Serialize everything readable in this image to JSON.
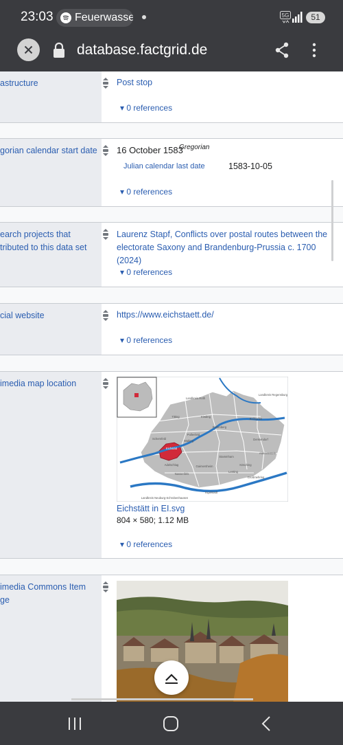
{
  "status_bar": {
    "time": "23:03",
    "notification_text": "Feuerwasse",
    "network_label": "5G",
    "battery": "51"
  },
  "browser": {
    "url": "database.factgrid.de"
  },
  "statements": [
    {
      "property": "astructure",
      "value": "Post stop",
      "references": "0 references"
    },
    {
      "property": "gorian calendar start date",
      "value": "16 October 1583",
      "calendar_note": "Gregorian",
      "qualifier_label": "Julian calendar last date",
      "qualifier_value": "1583-10-05",
      "references": "0 references"
    },
    {
      "property": "earch projects that\ntributed to this data set",
      "value": "Laurenz Stapf, Conflicts over postal routes between the electorate Saxony and Brandenburg-Prussia c. 1700 (2024)",
      "references": "0 references"
    },
    {
      "property": "cial website",
      "value": "https://www.eichstaett.de/",
      "references": "0 references"
    },
    {
      "property": "imedia map location",
      "file_name": "Eichstätt in EI.svg",
      "file_info": "804 × 580; 1.12 MB",
      "references": "0 references"
    },
    {
      "property": "imedia Commons Item\nge"
    }
  ],
  "map": {
    "labels": [
      "Landkreis Roth",
      "Titting",
      "Pollenfeld",
      "Kinding",
      "Beilngries",
      "Schernfeld",
      "Eichstätt",
      "Walting",
      "Denkendorf",
      "Adelschlag",
      "Kipfenberg",
      "Altmannstein",
      "Nassenfels",
      "Stammham",
      "Kösching",
      "Lenting",
      "Gaimersheim",
      "Großmehring",
      "Ingolstadt",
      "Landkreis Regensburg",
      "Landkreis Neuburg-Schrobenhausen"
    ]
  },
  "colors": {
    "link": "#2a5db0",
    "property_bg": "#eaecf0",
    "chrome": "#3a3b3f",
    "highlight": "#d12a3a",
    "river": "#2b78c4"
  }
}
